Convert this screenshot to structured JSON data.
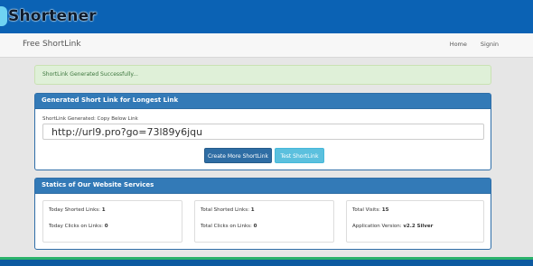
{
  "app": {
    "logo_text": "Shortener"
  },
  "nav": {
    "brand": "Free ShortLink",
    "links": [
      "Home",
      "Signin"
    ]
  },
  "alert": {
    "message": "ShortLink Generated Successfully..."
  },
  "generated": {
    "title": "Generated Short Link for Longest Link",
    "label": "ShortLink Generated: Copy Below Link",
    "short_url": "http://url9.pro?go=73l89y6jqu",
    "create_button": "Create More ShortLink",
    "test_button": "Test ShortLink"
  },
  "stats": {
    "title": "Statics of Our Website Services",
    "boxes": [
      {
        "row1_label": "Today Shorted Links:",
        "row1_value": "1",
        "row2_label": "Today Clicks on Links:",
        "row2_value": "0"
      },
      {
        "row1_label": "Total Shorted Links:",
        "row1_value": "1",
        "row2_label": "Total Clicks on Links:",
        "row2_value": "0"
      },
      {
        "row1_label": "Total Visits:",
        "row1_value": "15",
        "row2_label": "Application Version:",
        "row2_value": "v2.2 Silver"
      }
    ]
  },
  "colors": {
    "header_blue": "#0b62b4",
    "panel_blue": "#337ab7",
    "alert_green_bg": "#dff0d8",
    "button_primary": "#2e6da4",
    "button_info": "#5bc0de"
  }
}
